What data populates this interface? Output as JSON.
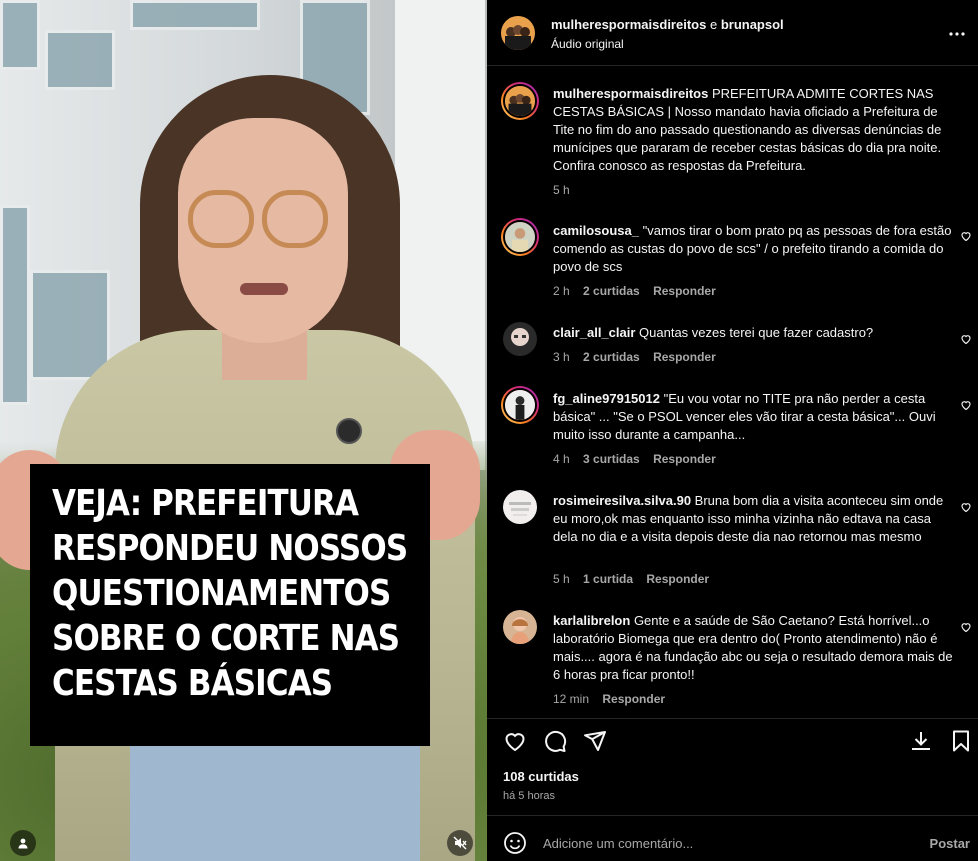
{
  "video": {
    "overlay_lines": [
      "VEJA: PREFEITURA",
      "RESPONDEU NOSSOS",
      "QUESTIONAMENTOS",
      "SOBRE O CORTE NAS",
      "CESTAS BÁSICAS"
    ],
    "user_icon": "user-tag-icon",
    "mute_icon": "muted-icon"
  },
  "header": {
    "author": "mulherespormaisdireitos",
    "joiner": "e",
    "coauthor": "brunapsol",
    "audio": "Áudio original",
    "more_icon": "more-options-icon"
  },
  "caption": {
    "username": "mulherespormaisdireitos",
    "text": "PREFEITURA ADMITE CORTES NAS CESTAS BÁSICAS | Nosso mandato havia oficiado a Prefeitura de Tite no fim do ano passado questionando as diversas denúncias de munícipes que pararam de receber cestas básicas do dia pra noite. Confira conosco as respostas da Prefeitura.",
    "time": "5 h"
  },
  "comments": [
    {
      "username": "camilosousa_",
      "text": "\"vamos tirar o bom prato pq as pessoas de fora estão comendo as custas do povo de scs\" / o prefeito tirando a comida do povo de scs",
      "time": "2 h",
      "likes": "2 curtidas",
      "reply": "Responder"
    },
    {
      "username": "clair_all_clair",
      "text": "Quantas vezes terei que fazer cadastro?",
      "time": "3 h",
      "likes": "2 curtidas",
      "reply": "Responder"
    },
    {
      "username": "fg_aline97915012",
      "text": "\"Eu vou votar no TITE pra não perder a cesta básica\" ... \"Se o PSOL vencer eles vão tirar a cesta básica\"... Ouvi muito isso durante a campanha...",
      "time": "4 h",
      "likes": "3 curtidas",
      "reply": "Responder"
    },
    {
      "username": "rosimeiresilva.silva.90",
      "text": "Bruna bom dia a visita aconteceu sim onde eu moro,ok mas enquanto isso minha vizinha não edtava na casa dela no dia e a visita depois deste dia nao retornou mas mesmo",
      "time": "5 h",
      "likes": "1 curtida",
      "reply": "Responder"
    },
    {
      "username": "karlalibrelon",
      "text": "Gente e a saúde de São Caetano? Está horrível...o laboratório Biomega que era dentro do( Pronto atendimento) não é mais.... agora é na fundação abc ou seja o resultado demora mais de 6 horas pra ficar pronto!!",
      "time": "12 min",
      "likes": "",
      "reply": "Responder"
    }
  ],
  "actions": {
    "icons": [
      "heart-icon",
      "comment-icon",
      "share-icon",
      "download-icon",
      "bookmark-icon"
    ]
  },
  "likes": "108 curtidas",
  "posted": "há 5 horas",
  "add_comment": {
    "emoji_icon": "emoji-icon",
    "placeholder": "Adicione um comentário...",
    "post_label": "Postar"
  }
}
